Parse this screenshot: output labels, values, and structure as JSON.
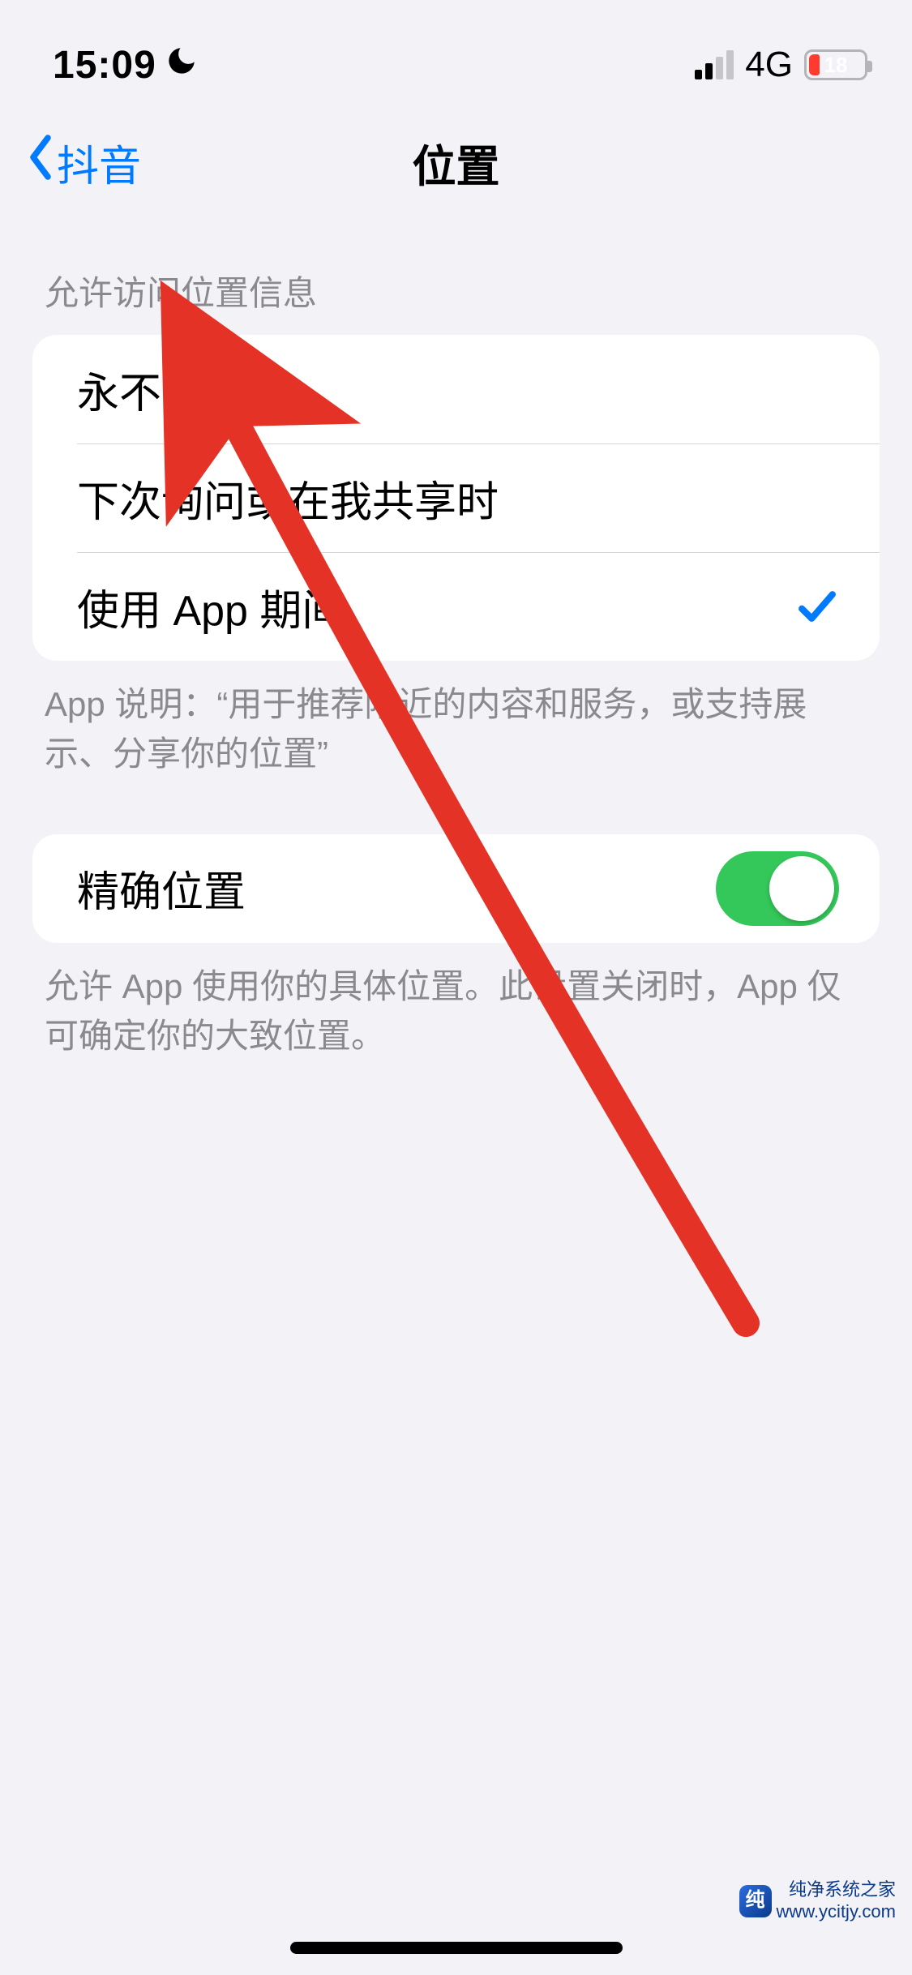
{
  "status": {
    "time": "15:09",
    "dnd_icon": "moon-icon",
    "network": "4G",
    "battery_pct": "18"
  },
  "nav": {
    "back_label": "抖音",
    "title": "位置"
  },
  "section1": {
    "header": "允许访问位置信息",
    "options": [
      {
        "label": "永不",
        "selected": false
      },
      {
        "label": "下次询问或在我共享时",
        "selected": false
      },
      {
        "label": "使用 App 期间",
        "selected": true
      }
    ],
    "footer": "App 说明：“用于推荐附近的内容和服务，或支持展示、分享你的位置”"
  },
  "section2": {
    "precise_label": "精确位置",
    "precise_on": true,
    "footer": "允许 App 使用你的具体位置。此设置关闭时，App 仅可确定你的大致位置。"
  },
  "watermark": {
    "line1": "纯净系统之家",
    "line2": "www.ycitjy.com"
  }
}
